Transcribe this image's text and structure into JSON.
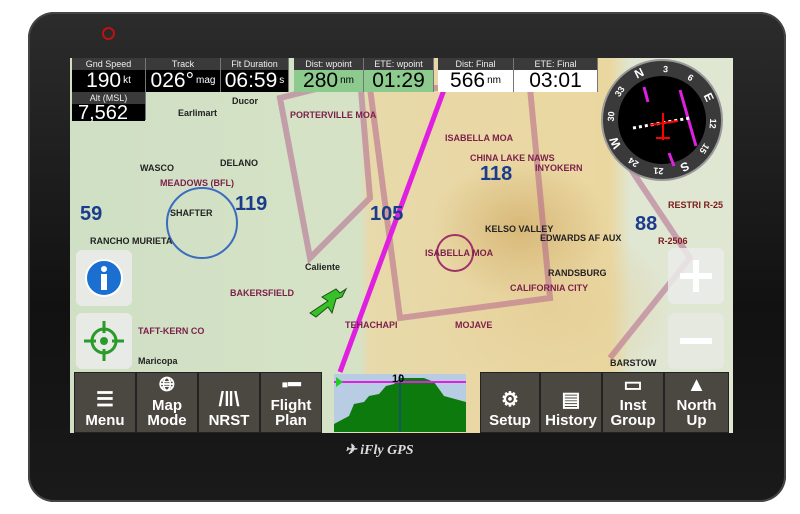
{
  "device": {
    "logo": "iFly GPS"
  },
  "top_bar": {
    "gnd_speed": {
      "label": "Gnd Speed",
      "value": "190",
      "unit": "kt"
    },
    "track": {
      "label": "Track",
      "value": "026°",
      "unit": "mag"
    },
    "flt_duration": {
      "label": "Flt Duration",
      "value": "06:59",
      "unit": "s"
    },
    "dist_wpoint": {
      "label": "Dist: wpoint",
      "value": "280",
      "unit": "nm"
    },
    "ete_wpoint": {
      "label": "ETE: wpoint",
      "value": "01:29"
    },
    "dist_final": {
      "label": "Dist: Final",
      "value": "566",
      "unit": "nm"
    },
    "ete_final": {
      "label": "ETE: Final",
      "value": "03:01"
    },
    "alt": {
      "label": "Alt (MSL)",
      "value": "7,562"
    }
  },
  "map_labels": [
    "PORTERVILLE MOA",
    "ISABELLA MOA",
    "BAKERSFIELD",
    "RANCHO MURIETA",
    "Earlimart",
    "Ducor",
    "DELANO",
    "WASCO",
    "SHAFTER",
    "MEADOWS (BFL)",
    "KELSO VALLEY",
    "CHINA LAKE NAWS",
    "INYOKERN",
    "RANDSBURG",
    "CALIFORNIA CITY",
    "MOJAVE",
    "TEHACHAPI",
    "Caliente",
    "Maricopa",
    "TAFT-KERN CO",
    "EDWARDS AF AUX",
    "R-2506",
    "RESTRI R-25",
    "BARSTOW",
    "105",
    "119",
    "118",
    "88",
    "59"
  ],
  "compass": {
    "labels": [
      "N",
      "3",
      "6",
      "E",
      "12",
      "15",
      "S",
      "21",
      "24",
      "W",
      "30",
      "33"
    ]
  },
  "profile": {
    "label": "10"
  },
  "bottom_bar": {
    "menu": "Menu",
    "map_mode": [
      "Map",
      "Mode"
    ],
    "nrst": "NRST",
    "flight_plan": [
      "Flight",
      "Plan"
    ],
    "setup": "Setup",
    "history": "History",
    "inst_group": [
      "Inst",
      "Group"
    ],
    "north_up": [
      "North",
      "Up"
    ]
  },
  "colors": {
    "route": "#e020e0",
    "ete_bg": "#8cca8e",
    "aircraft": "#38c02a"
  }
}
